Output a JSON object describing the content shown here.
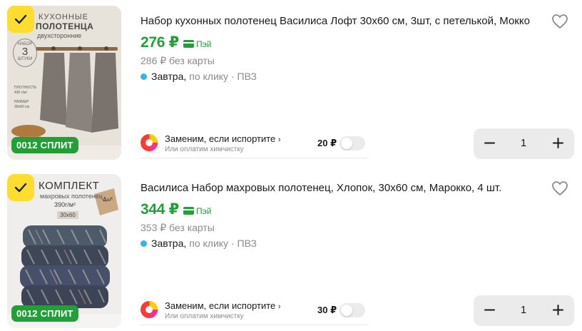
{
  "items": [
    {
      "title": "Набор кухонных полотенец Василиса Лофт 30х60 см, 3шт, с петелькой, Мокко",
      "price": "276 ₽",
      "pay_label": "Пэй",
      "old_price": "286 ₽ без карты",
      "delivery_when": "Завтра,",
      "delivery_rest": "по клику · ПВЗ",
      "split_badge": "0012 СПЛИТ",
      "insurance": {
        "title": "Заменим, если испортите",
        "subtitle": "Или оплатим химчистку",
        "price": "20 ₽"
      },
      "quantity": "1",
      "image_text": {
        "line1": "КУХОННЫЕ",
        "line2": "ПОЛОТЕНЦА",
        "line3": "двухсторонние",
        "set_label": "НАБОР",
        "set_count": "3",
        "set_unit": "ШТУКИ",
        "density_label": "ПЛОТНОСТЬ",
        "density_value": "430 г/м²",
        "size_label": "РАЗМЕР",
        "size_value": "30х60 см"
      }
    },
    {
      "title": "Василиса Набор махровых полотенец, Хлопок, 30х60 см, Марокко, 4 шт.",
      "price": "344 ₽",
      "pay_label": "Пэй",
      "old_price": "353 ₽ без карты",
      "delivery_when": "Завтра,",
      "delivery_rest": "по клику · ПВЗ",
      "split_badge": "0012 СПЛИТ",
      "insurance": {
        "title": "Заменим, если испортите",
        "subtitle": "Или оплатим химчистку",
        "price": "30 ₽"
      },
      "quantity": "1",
      "image_text": {
        "line1": "КОМПЛЕКТ",
        "line2": "махровых полотенец",
        "density_value": "390г/м²",
        "size_value": "30х60",
        "tag_count": "4",
        "tag_unit": "шт"
      }
    }
  ],
  "colors": {
    "price_green": "#21a038",
    "check_yellow": "#ffdd2e",
    "delivery_dot": "#2fb5f0",
    "muted_text": "#8b8b8b",
    "stepper_bg": "#ebebeb"
  },
  "icons": [
    "check-icon",
    "heart-icon",
    "pay-card-icon",
    "insurance-logo-icon",
    "chevron-right-icon",
    "minus-icon",
    "plus-icon"
  ]
}
